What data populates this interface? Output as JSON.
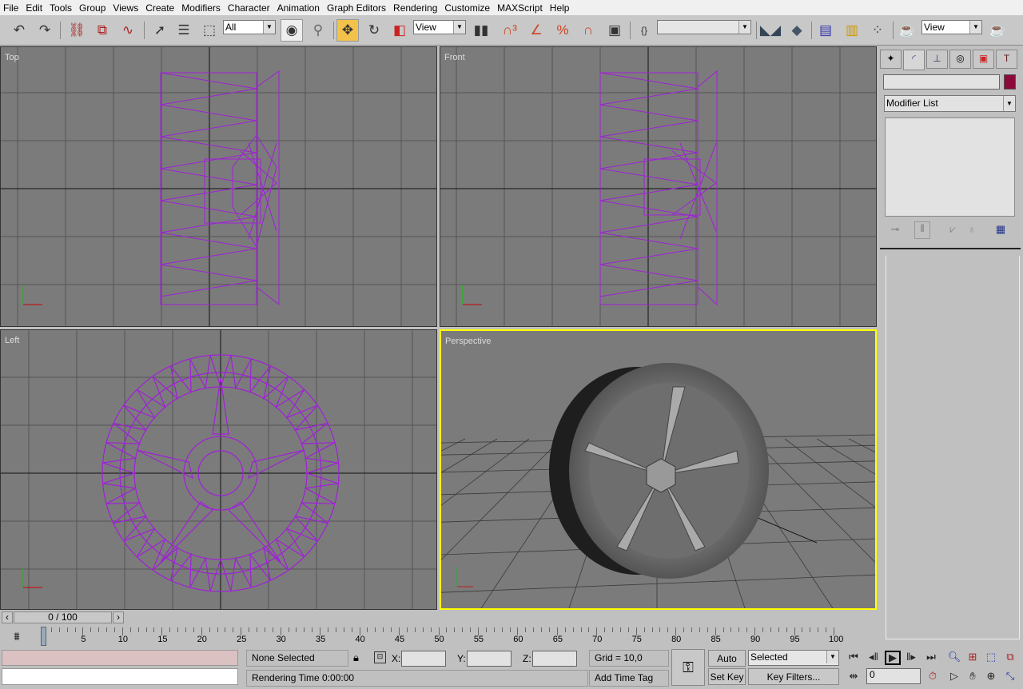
{
  "menu": [
    "File",
    "Edit",
    "Tools",
    "Group",
    "Views",
    "Create",
    "Modifiers",
    "Character",
    "Animation",
    "Graph Editors",
    "Rendering",
    "Customize",
    "MAXScript",
    "Help"
  ],
  "toolbar": {
    "selection_filter": "All",
    "ref_coord": "View",
    "named_sel": "",
    "render_type": "View",
    "icons": [
      "undo-icon",
      "redo-icon",
      "select-and-link-icon",
      "unlink-icon",
      "bind-space-warp-icon",
      "select-object-icon",
      "select-by-name-icon",
      "rectangular-selection-icon",
      "window-crossing-icon",
      "selection-center-icon",
      "move-icon",
      "rotate-icon",
      "scale-icon",
      "pivot-icon",
      "snap-3d-icon",
      "angle-snap-icon",
      "percent-snap-icon",
      "spinner-snap-icon",
      "named-selection-icon",
      "mirror-icon",
      "align-icon",
      "curve-editor-icon",
      "schematic-view-icon",
      "material-editor-icon",
      "render-scene-icon",
      "quick-render-icon"
    ]
  },
  "viewports": [
    {
      "label": "Top",
      "active": false
    },
    {
      "label": "Front",
      "active": false
    },
    {
      "label": "Left",
      "active": false
    },
    {
      "label": "Perspective",
      "active": true
    }
  ],
  "colors": {
    "wireframe": "#a020d8",
    "active_viewport": "#ffff00",
    "object_color": "#8b0a3a",
    "viewport_bg": "#7b7b7b"
  },
  "command_panel": {
    "tabs": [
      "create-icon",
      "modify-icon",
      "hierarchy-icon",
      "motion-icon",
      "display-icon",
      "utilities-icon"
    ],
    "object_name": "",
    "modifier_list": "Modifier List"
  },
  "timeline": {
    "slider_label": "0 / 100",
    "ticks": [
      "0",
      "5",
      "10",
      "15",
      "20",
      "25",
      "30",
      "35",
      "40",
      "45",
      "50",
      "55",
      "60",
      "65",
      "70",
      "75",
      "80",
      "85",
      "90",
      "95",
      "100"
    ],
    "current_frame": 0
  },
  "status": {
    "selection": "None Selected",
    "x_label": "X:",
    "y_label": "Y:",
    "z_label": "Z:",
    "x": "",
    "y": "",
    "z": "",
    "grid": "Grid = 10,0",
    "rendering_time": "Rendering Time  0:00:00",
    "add_time_tag": "Add Time Tag",
    "auto_key": "Auto Key",
    "set_key": "Set Key",
    "key_mode": "Selected",
    "key_filters": "Key Filters...",
    "frame_value": "0"
  }
}
